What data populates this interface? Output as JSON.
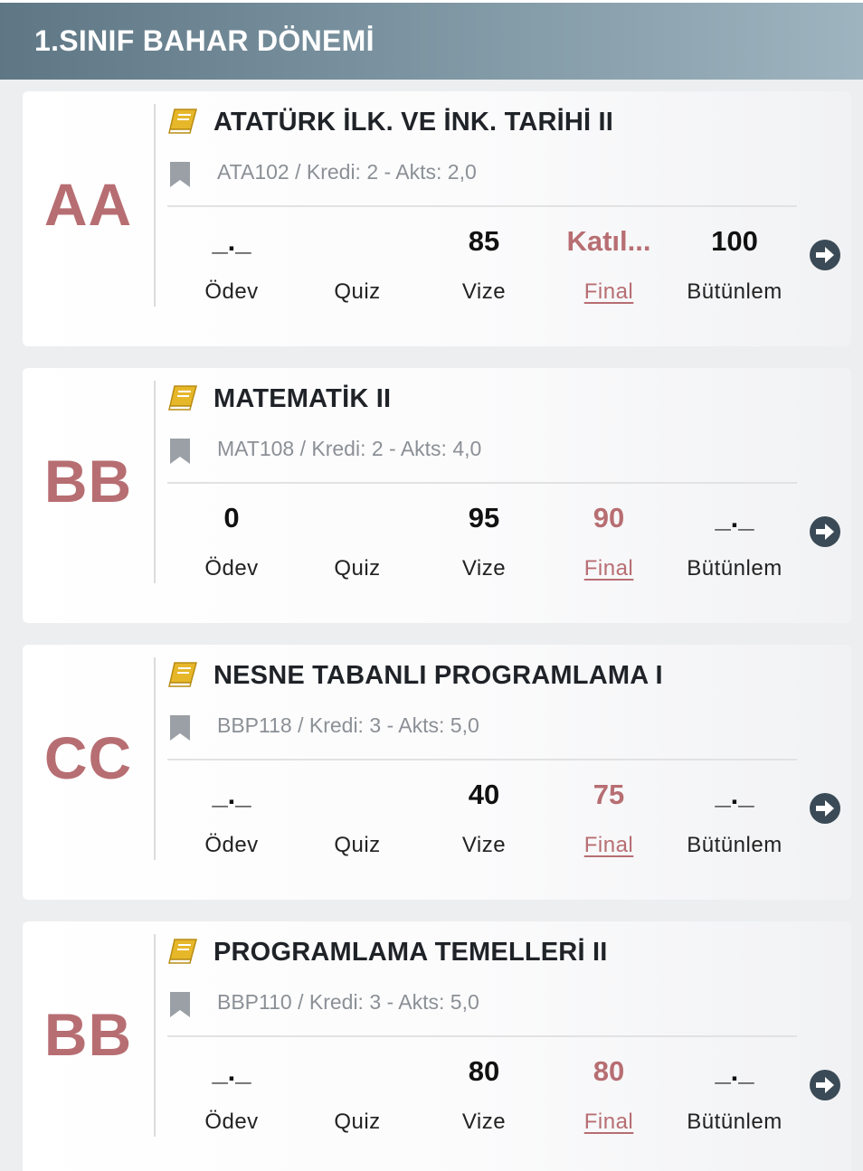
{
  "header": {
    "title": "1.SINIF BAHAR DÖNEMİ"
  },
  "labels": {
    "odev": "Ödev",
    "quiz": "Quiz",
    "vize": "Vize",
    "final": "Final",
    "butunlem": "Bütünlem"
  },
  "colors": {
    "accent": "#b76e72",
    "header_from": "#5f7785",
    "header_to": "#9eb4bf",
    "book_icon": "#e6b729",
    "bookmark": "#9aa0a6",
    "arrow": "#3a4a56"
  },
  "icons": {
    "book": "book-icon",
    "bookmark": "bookmark-icon",
    "arrow": "arrow-right-circle-icon"
  },
  "courses": [
    {
      "grade": "AA",
      "title": "ATATÜRK İLK. VE İNK. TARİHİ II",
      "meta": "ATA102 / Kredi: 2 - Akts: 2,0",
      "odev": "_._",
      "quiz": "",
      "vize": "85",
      "final": "Katıl...",
      "butunlem": "100"
    },
    {
      "grade": "BB",
      "title": "MATEMATİK II",
      "meta": "MAT108 / Kredi: 2 - Akts: 4,0",
      "odev": "0",
      "quiz": "",
      "vize": "95",
      "final": "90",
      "butunlem": "_._"
    },
    {
      "grade": "CC",
      "title": "NESNE TABANLI PROGRAMLAMA I",
      "meta": "BBP118 / Kredi: 3 - Akts: 5,0",
      "odev": "_._",
      "quiz": "",
      "vize": "40",
      "final": "75",
      "butunlem": "_._"
    },
    {
      "grade": "BB",
      "title": "PROGRAMLAMA TEMELLERİ II",
      "meta": "BBP110 / Kredi: 3 - Akts: 5,0",
      "odev": "_._",
      "quiz": "",
      "vize": "80",
      "final": "80",
      "butunlem": "_._"
    }
  ]
}
